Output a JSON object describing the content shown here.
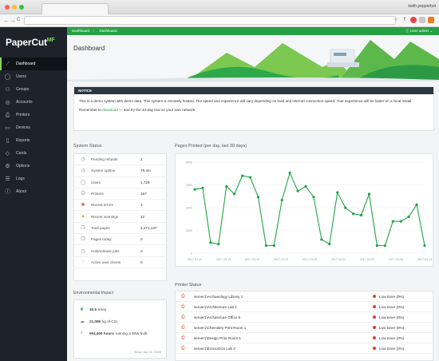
{
  "browser": {
    "user": "keith.pepperbot",
    "nav": {
      "back": "←",
      "forward": "→",
      "reload": "C"
    }
  },
  "sidebar": {
    "logo_main": "PaperCut",
    "logo_sup": "MF",
    "items": [
      {
        "label": "Dashboard",
        "icon": "dashboard-icon",
        "glyph": "⟋"
      },
      {
        "label": "Users",
        "icon": "user-icon",
        "glyph": "◯"
      },
      {
        "label": "Groups",
        "icon": "groups-icon",
        "glyph": "⚇"
      },
      {
        "label": "Accounts",
        "icon": "accounts-icon",
        "glyph": "◎"
      },
      {
        "label": "Printers",
        "icon": "printer-icon",
        "glyph": "⎙"
      },
      {
        "label": "Devices",
        "icon": "devices-icon",
        "glyph": "▭"
      },
      {
        "label": "Reports",
        "icon": "reports-icon",
        "glyph": "▯"
      },
      {
        "label": "Cards",
        "icon": "cards-icon",
        "glyph": "◇"
      },
      {
        "label": "Options",
        "icon": "options-icon",
        "glyph": "⚙"
      },
      {
        "label": "Logs",
        "icon": "logs-icon",
        "glyph": "☰"
      },
      {
        "label": "About",
        "icon": "about-icon",
        "glyph": "ⓘ"
      }
    ]
  },
  "topbar": {
    "crumb1": "Dashboard",
    "sep": "〉",
    "crumb2": "Dashboard",
    "user_menu": "User admin ⌄"
  },
  "page_title": "Dashboard",
  "notice": {
    "heading": "NOTICE",
    "line1": "This is a demo system with demo data. This system is remotely hosted. The speed and experience will vary depending on load and internet connection speed. Your experience will be faster on a local install.",
    "line2_pre": "Remember to ",
    "line2_link": "download",
    "line2_post": " — and try the 40-day trial on your own network."
  },
  "system_status": {
    "title": "System Status",
    "rows": [
      {
        "icon": "clock-icon",
        "glyph": "◷",
        "label": "Pending refunds",
        "value": "2",
        "color": "#888"
      },
      {
        "icon": "uptime-icon",
        "glyph": "◷",
        "label": "System uptime",
        "value": "79.4m",
        "color": "#888"
      },
      {
        "icon": "user-icon",
        "glyph": "◯",
        "label": "Users",
        "value": "1,726",
        "color": "#888"
      },
      {
        "icon": "printer-icon",
        "glyph": "⎙",
        "label": "Printers",
        "value": "167",
        "color": "#888"
      },
      {
        "icon": "error-icon",
        "glyph": "✖",
        "label": "Recent errors",
        "value": "2",
        "color": "#e04848"
      },
      {
        "icon": "warning-icon",
        "glyph": "▲",
        "label": "Recent warnings",
        "value": "22",
        "color": "#f0a020"
      },
      {
        "icon": "pages-icon",
        "glyph": "❐",
        "label": "Total pages",
        "value": "2,471,137",
        "color": "#888"
      },
      {
        "icon": "pages-today-icon",
        "glyph": "❐",
        "label": "Pages today",
        "value": "0",
        "color": "#888"
      },
      {
        "icon": "hold-release-icon",
        "glyph": "◷",
        "label": "Hold/release jobs",
        "value": "0",
        "color": "#888"
      },
      {
        "icon": "client-icon",
        "glyph": "◌",
        "label": "Active user clients",
        "value": "0",
        "color": "#888"
      }
    ]
  },
  "chart_data": {
    "type": "line",
    "title": "Pages Printed (per day, last 30 days)",
    "color": "#22a447",
    "ylim": [
      0,
      6000
    ],
    "yticks": [
      "6000",
      "4500",
      "3000",
      "1500",
      "0"
    ],
    "xticks": [
      "2017-03-11",
      "2017-03-15",
      "2017-03-19",
      "2017-03-23",
      "2017-03-28",
      "2017-04-01",
      "2017-04-05",
      "2017-04-09",
      "2017-04-13"
    ],
    "values": [
      4200,
      4300,
      700,
      600,
      4400,
      3900,
      5100,
      5000,
      3700,
      500,
      500,
      3500,
      5300,
      4100,
      4400,
      3700,
      900,
      600,
      4000,
      3000,
      2600,
      2500,
      3900,
      500,
      500,
      2100,
      2100,
      2400,
      3200,
      500
    ]
  },
  "environmental": {
    "title": "Environmental Impact",
    "trees_value": "30.5",
    "trees_label": "trees",
    "co2_value": "21,089",
    "co2_label": "kg of CO₂",
    "bulb_value": "694,600 hours",
    "bulb_label": "running a 60W bulb",
    "since": "Since Jan 01, 2009"
  },
  "printer_status": {
    "title": "Printer Status",
    "rows": [
      {
        "name": "server1\\Archaeology Library 1",
        "status": "Low toner (0%)"
      },
      {
        "name": "server1\\Architecture Lab 1",
        "status": "Low toner (0%)"
      },
      {
        "name": "server1\\Architecture Office 5",
        "status": "Low toner (0%)"
      },
      {
        "name": "server1\\Chemistry Print Room 1",
        "status": "Low toner (0%)"
      },
      {
        "name": "server1\\Design Print Room 1",
        "status": "Low toner (0%)"
      },
      {
        "name": "server1\\Economics Lab 3",
        "status": "Low toner (0%)"
      }
    ]
  }
}
